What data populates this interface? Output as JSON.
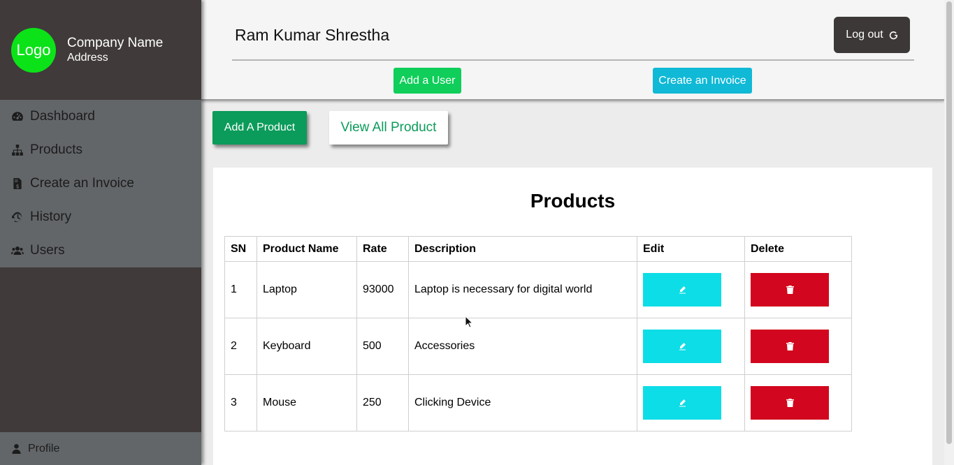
{
  "sidebar": {
    "logo_text": "Logo",
    "company_name": "Company Name",
    "company_address": "Address",
    "items": [
      {
        "label": "Dashboard",
        "icon": "dashboard-icon"
      },
      {
        "label": "Products",
        "icon": "sitemap-icon"
      },
      {
        "label": "Create an Invoice",
        "icon": "file-invoice-icon"
      },
      {
        "label": "History",
        "icon": "history-icon"
      },
      {
        "label": "Users",
        "icon": "users-icon"
      }
    ],
    "profile_label": "Profile"
  },
  "header": {
    "user_name": "Ram Kumar Shrestha",
    "logout_label": "Log out",
    "add_user_label": "Add a User",
    "create_invoice_label": "Create an Invoice"
  },
  "actions": {
    "add_product_label": "Add A Product",
    "view_all_label": "View All Product"
  },
  "products": {
    "title": "Products",
    "columns": [
      "SN",
      "Product Name",
      "Rate",
      "Description",
      "Edit",
      "Delete"
    ],
    "rows": [
      {
        "sn": "1",
        "name": "Laptop",
        "rate": "93000",
        "description": "Laptop is necessary for digital world"
      },
      {
        "sn": "2",
        "name": "Keyboard",
        "rate": "500",
        "description": "Accessories"
      },
      {
        "sn": "3",
        "name": "Mouse",
        "rate": "250",
        "description": "Clicking Device"
      }
    ]
  },
  "colors": {
    "sidebar_bg": "#403a3a",
    "nav_bg": "#636669",
    "logo_green": "#0be318",
    "add_product_green": "#0b9b5a",
    "edit_cyan": "#0ddde6",
    "delete_red": "#d2061e",
    "invoice_blue": "#10b9d6"
  }
}
